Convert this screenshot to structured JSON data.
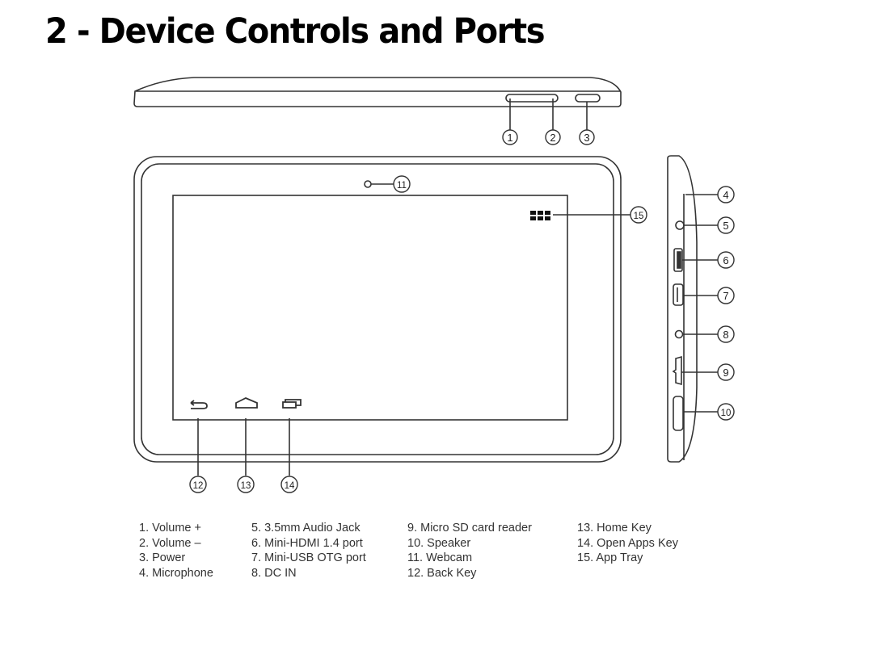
{
  "page": {
    "title": "2 - Device Controls and Ports"
  },
  "diagram": {
    "views": [
      "top-edge",
      "front",
      "right-side"
    ],
    "callouts": [
      {
        "number": "1",
        "view": "top-edge"
      },
      {
        "number": "2",
        "view": "top-edge"
      },
      {
        "number": "3",
        "view": "top-edge"
      },
      {
        "number": "4",
        "view": "right-side"
      },
      {
        "number": "5",
        "view": "right-side"
      },
      {
        "number": "6",
        "view": "right-side"
      },
      {
        "number": "7",
        "view": "right-side"
      },
      {
        "number": "8",
        "view": "right-side"
      },
      {
        "number": "9",
        "view": "right-side"
      },
      {
        "number": "10",
        "view": "right-side"
      },
      {
        "number": "11",
        "view": "front"
      },
      {
        "number": "12",
        "view": "front"
      },
      {
        "number": "13",
        "view": "front"
      },
      {
        "number": "14",
        "view": "front"
      },
      {
        "number": "15",
        "view": "front"
      }
    ],
    "icons": {
      "back": "back-arrow-icon",
      "home": "home-icon",
      "recent": "recent-apps-icon",
      "app_tray": "app-grid-icon",
      "webcam": "webcam-icon"
    }
  },
  "legend": {
    "columns": [
      [
        "1. Volume +",
        "2. Volume –",
        "3. Power",
        "4. Microphone"
      ],
      [
        "5. 3.5mm Audio Jack",
        "6. Mini-HDMI 1.4 port",
        "7. Mini-USB OTG port",
        "8. DC IN"
      ],
      [
        "9. Micro SD card reader",
        "10. Speaker",
        "11. Webcam",
        "12. Back Key"
      ],
      [
        "13. Home Key",
        "14. Open Apps Key",
        "15. App Tray"
      ]
    ]
  }
}
